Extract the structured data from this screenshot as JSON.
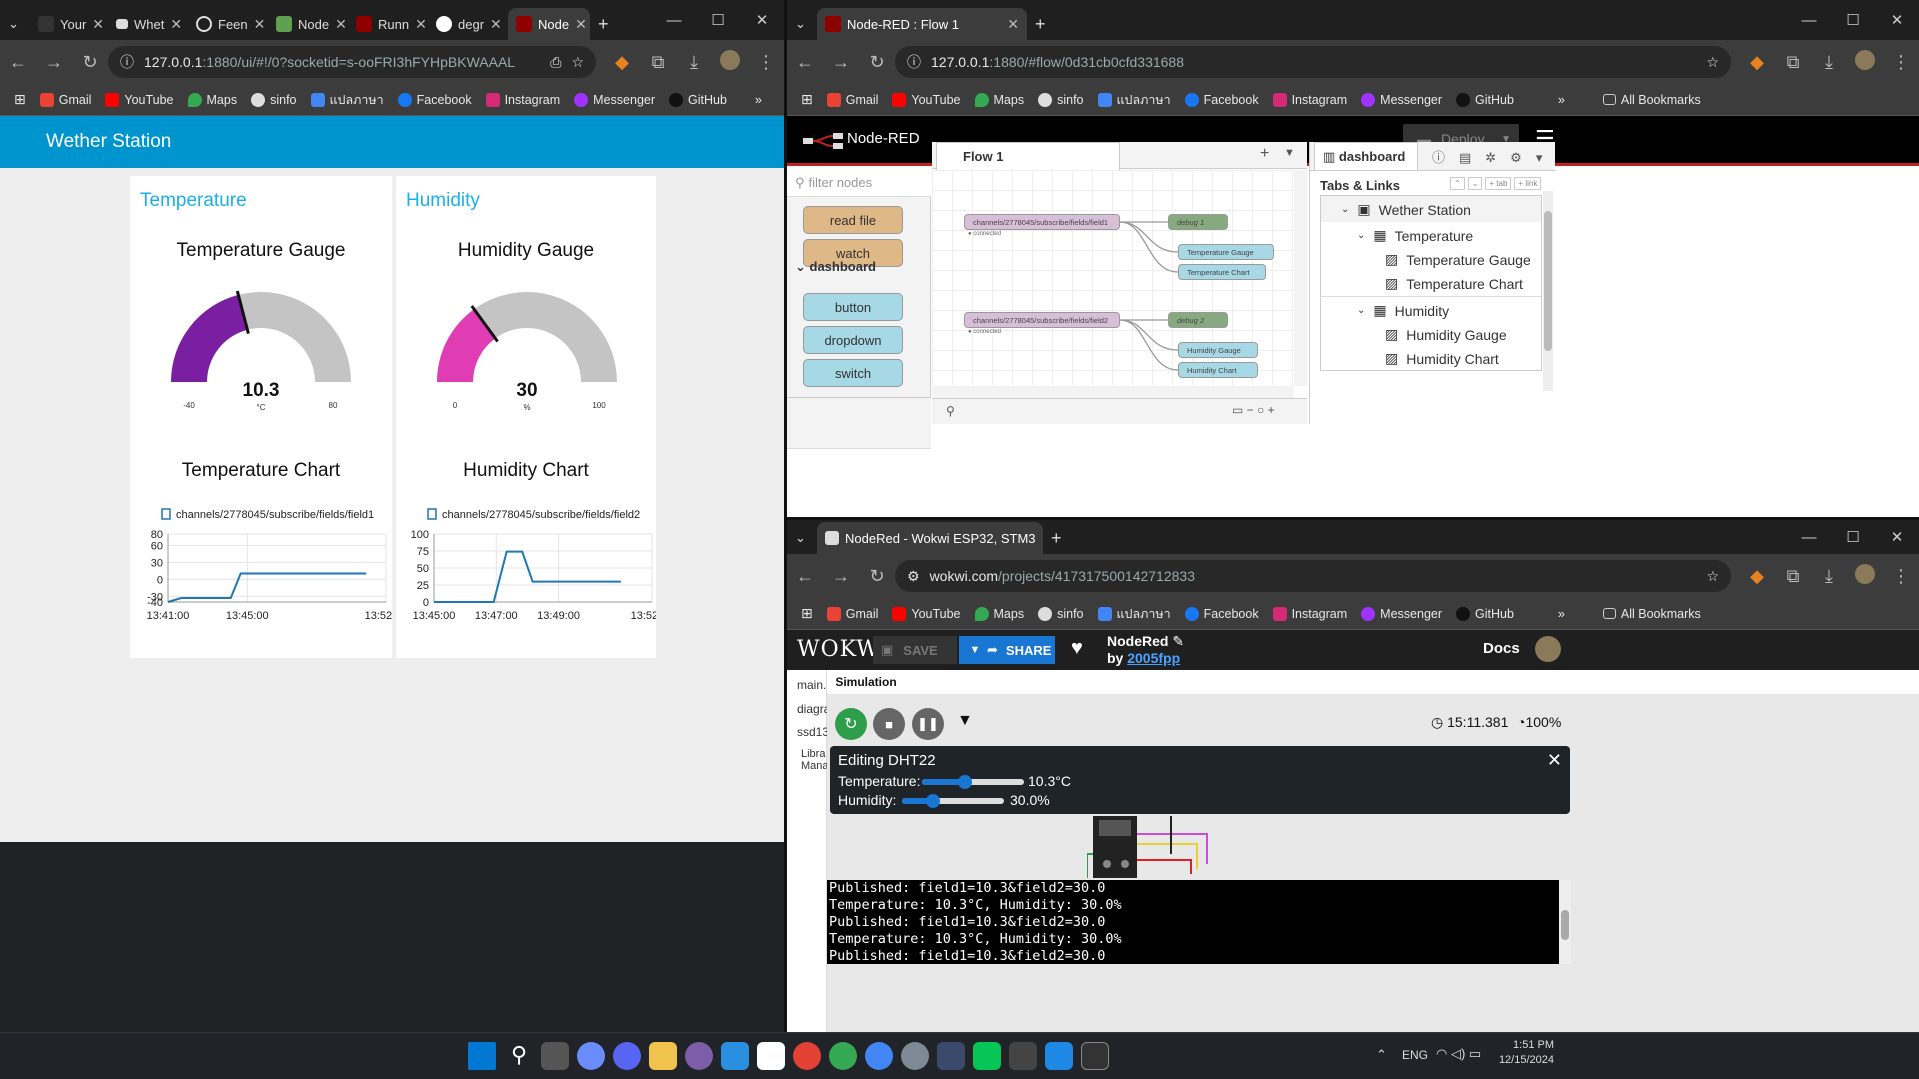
{
  "left_browser": {
    "tabs": [
      "Your",
      "Whet",
      "Feen",
      "Node",
      "Runn",
      "degr",
      "Node"
    ],
    "url": "127.0.0.1:1880/ui/#!/0?socketid=s-ooFRI3hFYHpBKWAAAL",
    "url_host": "127.0.0.1",
    "url_rest": ":1880/ui/#!/0?socketid=s-ooFRI3hFYHpBKWAAAL"
  },
  "bookmarks": {
    "items": [
      "Gmail",
      "YouTube",
      "Maps",
      "sinfo",
      "แปลภาษา",
      "Facebook",
      "Instagram",
      "Messenger",
      "GitHub"
    ],
    "overflow": "»",
    "all": "All Bookmarks"
  },
  "dashboard": {
    "header": "Wether Station",
    "temperature_group": "Temperature",
    "humidity_group": "Humidity",
    "temp_gauge": {
      "title": "Temperature Gauge",
      "value": "10.3",
      "unit": "°C",
      "min": "-40",
      "max": "80",
      "fraction": 0.419,
      "color": "#7b1fa2"
    },
    "hum_gauge": {
      "title": "Humidity Gauge",
      "value": "30",
      "unit": "%",
      "min": "0",
      "max": "100",
      "fraction": 0.3,
      "color": "#e03cb3"
    },
    "temp_chart_title": "Temperature Chart",
    "hum_chart_title": "Humidity Chart"
  },
  "chart_data": [
    {
      "type": "line",
      "title": "Temperature Chart",
      "series": [
        {
          "name": "channels/2778045/subscribe/fields/field1",
          "x": [
            "13:41:00",
            "13:41:40",
            "13:43:40",
            "13:44:10",
            "13:44:40",
            "13:51:00"
          ],
          "values": [
            -40,
            -33,
            -33,
            -33,
            10.3,
            10.3
          ]
        }
      ],
      "y_ticks": [
        "80",
        "60",
        "30",
        "0",
        "-30",
        "-40"
      ],
      "x_ticks": [
        "13:41:00",
        "13:45:00",
        "13:52:00"
      ],
      "ylim": [
        -40,
        80
      ],
      "grid": true,
      "legend": "top-left",
      "color": "#1f77b4"
    },
    {
      "type": "line",
      "title": "Humidity Chart",
      "series": [
        {
          "name": "channels/2778045/subscribe/fields/field2",
          "x": [
            "13:45:00",
            "13:46:55",
            "13:47:20",
            "13:47:50",
            "13:48:10",
            "13:51:00"
          ],
          "values": [
            0,
            0,
            74,
            74,
            30,
            30
          ]
        }
      ],
      "y_ticks": [
        "100",
        "75",
        "50",
        "25",
        "0"
      ],
      "x_ticks": [
        "13:45:00",
        "13:47:00",
        "13:49:00",
        "13:52:00"
      ],
      "ylim": [
        0,
        100
      ],
      "grid": true,
      "legend": "top-left",
      "color": "#1f77b4"
    }
  ],
  "nodered_browser": {
    "tab": "Node-RED : Flow 1",
    "url_host": "127.0.0.1",
    "url_rest": ":1880/#flow/0d31cb0cfd331688",
    "app_name": "Node-RED",
    "deploy": "Deploy",
    "filter_placeholder": "filter nodes",
    "palette_nodes": [
      "read file",
      "watch"
    ],
    "palette_category": "dashboard",
    "dashboard_nodes": [
      "button",
      "dropdown",
      "switch"
    ],
    "flow_tab": "Flow 1",
    "sidebar_tab": "dashboard",
    "tabs_links": "Tabs & Links",
    "btn_tab": "+ tab",
    "btn_link": "+ link",
    "tree": [
      "Wether Station",
      "Temperature",
      "Temperature Gauge",
      "Temperature Chart",
      "Humidity",
      "Humidity Gauge",
      "Humidity Chart"
    ],
    "flow_nodes": {
      "mqtt1": "channels/2778045/subscribe/fields/field1",
      "mqtt2": "channels/2778045/subscribe/fields/field2",
      "connected": "connected",
      "debug1": "debug 1",
      "debug2": "debug 2",
      "tg": "Temperature Gauge",
      "tc": "Temperature Chart",
      "hg": "Humidity Gauge",
      "hc": "Humidity Chart"
    }
  },
  "wokwi_browser": {
    "tab": "NodeRed - Wokwi ESP32, STM3",
    "url_host": "wokwi.com",
    "url_rest": "/projects/417317500142712833",
    "logo": "WOKWi",
    "save": "SAVE",
    "share": "SHARE",
    "project": "NodeRed",
    "by": "by",
    "author": "2005fpp",
    "docs": "Docs",
    "file_tabs": [
      "main.",
      "Simulation"
    ],
    "side_files": [
      "diagra",
      "ssd13",
      "Libra",
      "Mana"
    ],
    "timer": "15:11.381",
    "speed": "100%",
    "editor_title": "Editing DHT22",
    "temp_label": "Temperature:",
    "temp_value": "10.3°C",
    "temp_fraction": 0.42,
    "hum_label": "Humidity:",
    "hum_value": "30.0%",
    "hum_fraction": 0.3,
    "serial": [
      "Published: field1=10.3&field2=30.0",
      "Temperature: 10.3°C, Humidity: 30.0%",
      "Published: field1=10.3&field2=30.0",
      "Temperature: 10.3°C, Humidity: 30.0%",
      "Published: field1=10.3&field2=30.0"
    ]
  },
  "taskbar": {
    "lang": "ENG",
    "time": "1:51 PM",
    "date": "12/15/2024"
  }
}
